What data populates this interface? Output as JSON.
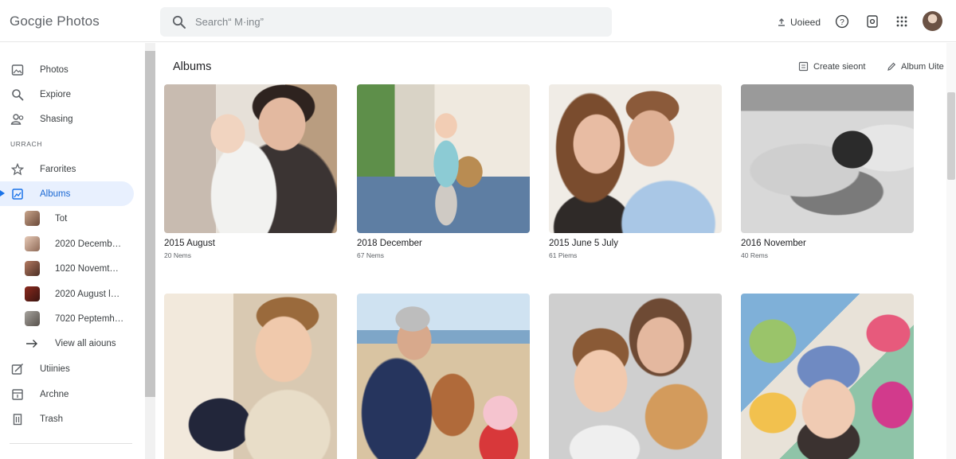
{
  "app": {
    "title": "Gocgie Photos"
  },
  "search": {
    "placeholder": "Search“ M·ing”"
  },
  "header": {
    "upload_label": "Uoieed",
    "upload_icon": "upload-icon",
    "help_icon": "help-icon",
    "settings_icon": "settings-icon",
    "apps_icon": "apps-grid-icon"
  },
  "sidebar": {
    "items": [
      {
        "label": "Photos",
        "icon": "photo-icon"
      },
      {
        "label": "Expiore",
        "icon": "search-icon"
      },
      {
        "label": "Shasing",
        "icon": "people-icon"
      }
    ],
    "section_label": "URRACH",
    "library": [
      {
        "label": "Farorites",
        "icon": "star-icon"
      },
      {
        "label": "Albums",
        "icon": "album-icon",
        "active": true
      }
    ],
    "albums": [
      {
        "label": "Tot"
      },
      {
        "label": "2020 Decemb…"
      },
      {
        "label": "1020 Novemt…"
      },
      {
        "label": "2020 August l…"
      },
      {
        "label": "7020 Peptemh…"
      }
    ],
    "view_all": "View all aiouns",
    "bottom": [
      {
        "label": "Utiinies",
        "icon": "utilities-icon"
      },
      {
        "label": "Archne",
        "icon": "archive-icon"
      },
      {
        "label": "Trash",
        "icon": "trash-icon"
      }
    ]
  },
  "main": {
    "title": "Albums",
    "actions": [
      {
        "label": "Create sieont",
        "icon": "create-icon"
      },
      {
        "label": "Album Uite",
        "icon": "edit-icon"
      }
    ],
    "albums": [
      {
        "title": "2015 August",
        "count": "20 Nems"
      },
      {
        "title": "2018 December",
        "count": "67 Nems"
      },
      {
        "title": "2015 June 5 July",
        "count": "61 Piems"
      },
      {
        "title": "2016 November",
        "count": "40 Rems"
      },
      {
        "title": "",
        "count": ""
      },
      {
        "title": "",
        "count": ""
      },
      {
        "title": "",
        "count": ""
      },
      {
        "title": "",
        "count": ""
      }
    ]
  },
  "colors": {
    "accent": "#1a73e8",
    "active_bg": "#e8f0fe",
    "search_bg": "#f1f3f4"
  }
}
